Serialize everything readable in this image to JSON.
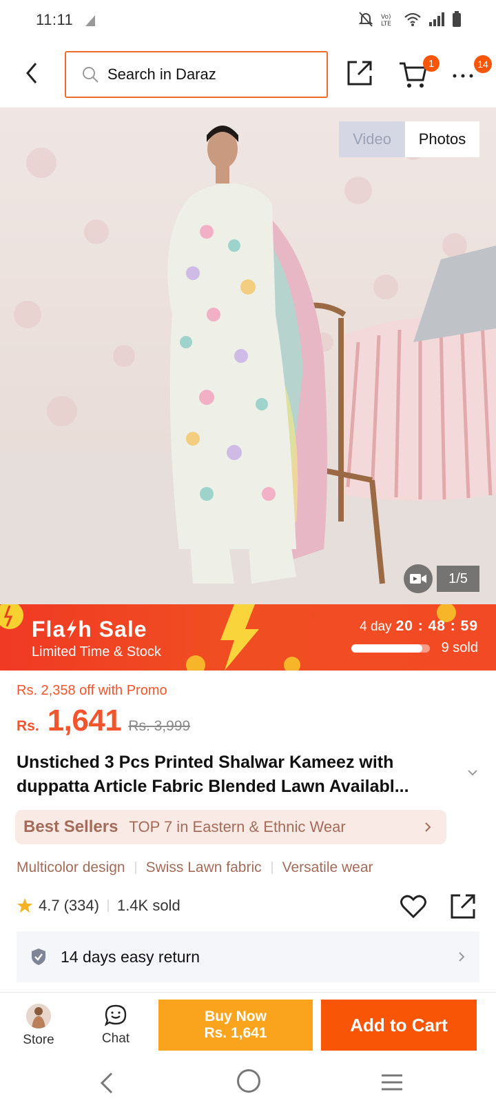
{
  "status_bar": {
    "time": "11:11",
    "icons": [
      "mute-icon",
      "volte-icon",
      "wifi-icon",
      "signal-icon",
      "battery-icon"
    ]
  },
  "header": {
    "search_placeholder": "Search in Daraz",
    "cart_badge": "1",
    "more_badge": "14"
  },
  "gallery": {
    "tabs": [
      {
        "label": "Video",
        "active": false
      },
      {
        "label": "Photos",
        "active": true
      }
    ],
    "counter": "1/5"
  },
  "flash_sale": {
    "title": "Fla⚡h Sale",
    "title_left": "Fla",
    "title_right": "h Sale",
    "subtitle": "Limited Time & Stock",
    "days": "4 day",
    "time": "20 : 48 : 59",
    "sold": "9 sold",
    "progress": 0.9
  },
  "price": {
    "promo": "Rs. 2,358 off with Promo",
    "currency": "Rs.",
    "value": "1,641",
    "original": "Rs. 3,999"
  },
  "product": {
    "title": "Unstiched 3 Pcs Printed Shalwar Kameez with duppatta Article Fabric Blended Lawn Availabl...",
    "best_sellers_label": "Best Sellers",
    "best_sellers_rank": "TOP 7 in Eastern & Ethnic Wear",
    "tags": [
      "Multicolor design",
      "Swiss Lawn fabric",
      "Versatile wear"
    ],
    "rating": "4.7",
    "reviews": "(334)",
    "sold": "1.4K sold"
  },
  "service": {
    "return_text": "14 days easy return"
  },
  "bottom_bar": {
    "store_label": "Store",
    "chat_label": "Chat",
    "buy_now_label": "Buy Now",
    "buy_now_price": "Rs. 1,641",
    "add_to_cart_label": "Add to Cart"
  },
  "colors": {
    "brand_orange": "#f85606",
    "buy_now": "#f9a41c",
    "price": "#f2542d",
    "search_border": "#f06a2d"
  }
}
